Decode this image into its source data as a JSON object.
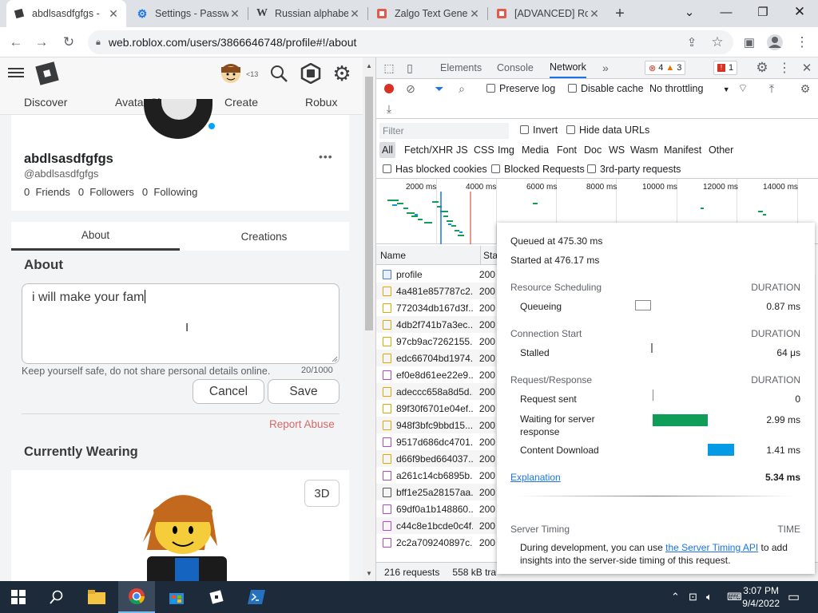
{
  "browser": {
    "tabs": [
      {
        "title": "abdlsasdfgfgs -",
        "icon": "roblox-page-icon",
        "active": true
      },
      {
        "title": "Settings - Passw",
        "icon": "gear-icon"
      },
      {
        "title": "Russian alphabe",
        "icon": "wikipedia-icon"
      },
      {
        "title": "Zalgo Text Gene",
        "icon": "page-icon"
      },
      {
        "title": "[ADVANCED] Ro",
        "icon": "page-icon"
      }
    ],
    "new_tab": "+",
    "url": "web.roblox.com/users/3866646748/profile#!/about"
  },
  "roblox": {
    "nav": [
      "Discover",
      "Avatar Shop",
      "Create",
      "Robux"
    ],
    "age_badge": "<13",
    "profile": {
      "display_name": "abdlsasdfgfgs",
      "handle": "@abdlsasdfgfgs",
      "friends": {
        "count": "0",
        "label": "Friends"
      },
      "followers": {
        "count": "0",
        "label": "Followers"
      },
      "following": {
        "count": "0",
        "label": "Following"
      },
      "more": "•••"
    },
    "tabs": [
      "About",
      "Creations"
    ],
    "about": {
      "heading": "About",
      "text": "i will make your fam",
      "hint": "Keep yourself safe, do not share personal details online.",
      "count": "20/1000",
      "cancel": "Cancel",
      "save": "Save",
      "report": "Report Abuse"
    },
    "wearing": {
      "heading": "Currently Wearing",
      "btn_3d": "3D"
    }
  },
  "devtools": {
    "tabs": [
      "Elements",
      "Console",
      "Network"
    ],
    "active_tab": "Network",
    "more": "»",
    "badges": {
      "errors": "4",
      "warnings": "3",
      "issues": "1"
    },
    "toolbar": {
      "preserve_log": "Preserve log",
      "disable_cache": "Disable cache",
      "throttling": "No throttling"
    },
    "filter": {
      "placeholder": "Filter",
      "invert": "Invert",
      "hide_data_urls": "Hide data URLs"
    },
    "types": [
      "All",
      "Fetch/XHR",
      "JS",
      "CSS",
      "Img",
      "Media",
      "Font",
      "Doc",
      "WS",
      "Wasm",
      "Manifest",
      "Other"
    ],
    "blocked": {
      "cookies": "Has blocked cookies",
      "requests": "Blocked Requests",
      "third_party": "3rd-party requests"
    },
    "overview_ticks": [
      "2000 ms",
      "4000 ms",
      "6000 ms",
      "8000 ms",
      "10000 ms",
      "12000 ms",
      "14000 ms"
    ],
    "columns": {
      "name": "Name",
      "status": "Sta"
    },
    "requests": [
      {
        "name": "profile",
        "status": "200",
        "type": "doc"
      },
      {
        "name": "4a481e857787c2...",
        "status": "200",
        "type": "js"
      },
      {
        "name": "772034db167d3f...",
        "status": "200",
        "type": "js"
      },
      {
        "name": "4db2f741b7a3ec...",
        "status": "200",
        "type": "js"
      },
      {
        "name": "97cb9ac7262155...",
        "status": "200",
        "type": "js"
      },
      {
        "name": "edc66704bd1974...",
        "status": "200",
        "type": "js"
      },
      {
        "name": "ef0e8d61ee22e9...",
        "status": "200",
        "type": "css"
      },
      {
        "name": "adeccc658a8d5d...",
        "status": "200",
        "type": "js"
      },
      {
        "name": "89f30f6701e04ef...",
        "status": "200",
        "type": "js"
      },
      {
        "name": "948f3bfc9bbd15...",
        "status": "200",
        "type": "js"
      },
      {
        "name": "9517d686dc4701...",
        "status": "200",
        "type": "css"
      },
      {
        "name": "d66f9bed664037...",
        "status": "200",
        "type": "js"
      },
      {
        "name": "a261c14cb6895b...",
        "status": "200",
        "type": "css"
      },
      {
        "name": "bff1e25a28157aa...",
        "status": "200",
        "type": "img"
      },
      {
        "name": "69df0a1b148860...",
        "status": "200",
        "type": "css"
      },
      {
        "name": "c44c8e1bcde0c4f...",
        "status": "200",
        "type": "css"
      },
      {
        "name": "2c2a709240897c...",
        "status": "200",
        "type": "css"
      }
    ],
    "status_bar": {
      "requests": "216 requests",
      "transferred": "558 kB tra"
    },
    "timing": {
      "queued": "Queued at 475.30 ms",
      "started": "Started at 476.17 ms",
      "duration_label": "DURATION",
      "sections": [
        {
          "title": "Resource Scheduling",
          "rows": [
            {
              "label": "Queueing",
              "value": "0.87 ms"
            }
          ]
        },
        {
          "title": "Connection Start",
          "rows": [
            {
              "label": "Stalled",
              "value": "64 μs"
            }
          ]
        },
        {
          "title": "Request/Response",
          "rows": [
            {
              "label": "Request sent",
              "value": "0"
            },
            {
              "label": "Waiting for server response",
              "value": "2.99 ms"
            },
            {
              "label": "Content Download",
              "value": "1.41 ms"
            }
          ]
        }
      ],
      "explanation": "Explanation",
      "total": "5.34 ms",
      "server_timing": "Server Timing",
      "time_label": "TIME",
      "server_text_before": "During development, you can use ",
      "server_link": "the Server Timing API",
      "server_text_after": " to add insights into the server-side timing of this request.",
      "colors": {
        "waiting": "#0f9d58",
        "download": "#039be5"
      }
    }
  },
  "taskbar": {
    "time": "3:07 PM",
    "date": "9/4/2022"
  }
}
